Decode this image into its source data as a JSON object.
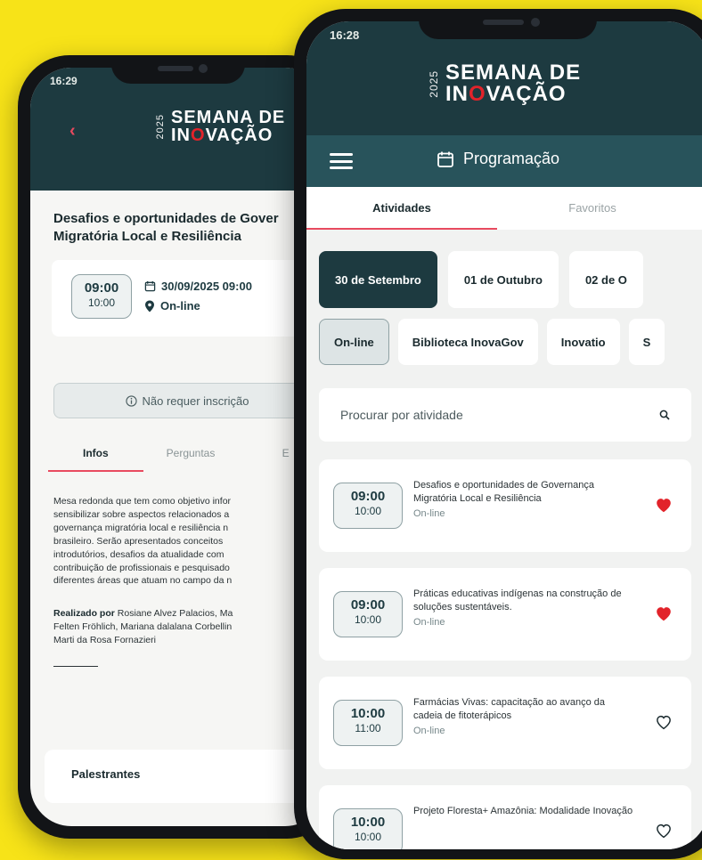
{
  "left_screen": {
    "status_time": "16:29",
    "brand": {
      "year": "2025",
      "line1": "SEMANA DE",
      "line2_pre": "IN",
      "line2_dot": "O",
      "line2_post": "VAÇÃO"
    },
    "title": "Desafios e oportunidades de Gover Migratória Local e Resiliência",
    "time_start": "09:00",
    "time_end": "10:00",
    "date": "30/09/2025 09:00",
    "location": "On-line",
    "registration_note": "Não requer inscrição",
    "tabs": [
      {
        "label": "Infos",
        "active": true
      },
      {
        "label": "Perguntas",
        "active": false
      },
      {
        "label": "E",
        "active": false
      }
    ],
    "description_lines": [
      "Mesa redonda que tem como objetivo infor",
      "sensibilizar sobre aspectos relacionados a",
      "governança migratória local e resiliência n",
      "brasileiro. Serão apresentados conceitos",
      "introdutórios, desafios da atualidade com",
      "contribuição de profissionais e pesquisado",
      "diferentes áreas que atuam no campo da n"
    ],
    "credits_label": "Realizado por",
    "credits_lines": [
      " Rosiane Alvez Palacios, Ma",
      "Felten Fröhlich, Mariana dalalana Corbellin",
      "Marti da Rosa Fornazieri"
    ],
    "speakers_label": "Palestrantes"
  },
  "right_screen": {
    "status_time": "16:28",
    "brand": {
      "year": "2025",
      "line1": "SEMANA DE",
      "line2_pre": "IN",
      "line2_dot": "O",
      "line2_post": "VAÇÃO"
    },
    "nav_title": "Programação",
    "tabs": [
      {
        "label": "Atividades",
        "active": true
      },
      {
        "label": "Favoritos",
        "active": false
      }
    ],
    "dates": [
      {
        "label": "30 de Setembro",
        "active": true
      },
      {
        "label": "01 de Outubro",
        "active": false
      },
      {
        "label": "02 de O",
        "active": false
      }
    ],
    "locations": [
      {
        "label": "On-line",
        "active": true
      },
      {
        "label": "Biblioteca InovaGov",
        "active": false
      },
      {
        "label": "Inovatio",
        "active": false
      },
      {
        "label": "S",
        "active": false
      }
    ],
    "search_placeholder": "Procurar por atividade",
    "activities": [
      {
        "start": "09:00",
        "end": "10:00",
        "title": "Desafios e oportunidades de Governança Migratória Local e Resiliência",
        "place": "On-line",
        "favorite": true
      },
      {
        "start": "09:00",
        "end": "10:00",
        "title": "Práticas educativas indígenas na construção de soluções sustentáveis.",
        "place": "On-line",
        "favorite": true
      },
      {
        "start": "10:00",
        "end": "11:00",
        "title": "Farmácias Vivas: capacitação ao avanço da cadeia de fitoterápicos",
        "place": "On-line",
        "favorite": false
      },
      {
        "start": "10:00",
        "end": "10:00",
        "title": "Projeto Floresta+ Amazônia: Modalidade Inovação",
        "place": "",
        "favorite": false
      }
    ]
  },
  "colors": {
    "background": "#f7e318",
    "header": "#1d3a40",
    "navbar": "#28535b",
    "accent": "#e84a5f",
    "heart": "#e2232a"
  }
}
